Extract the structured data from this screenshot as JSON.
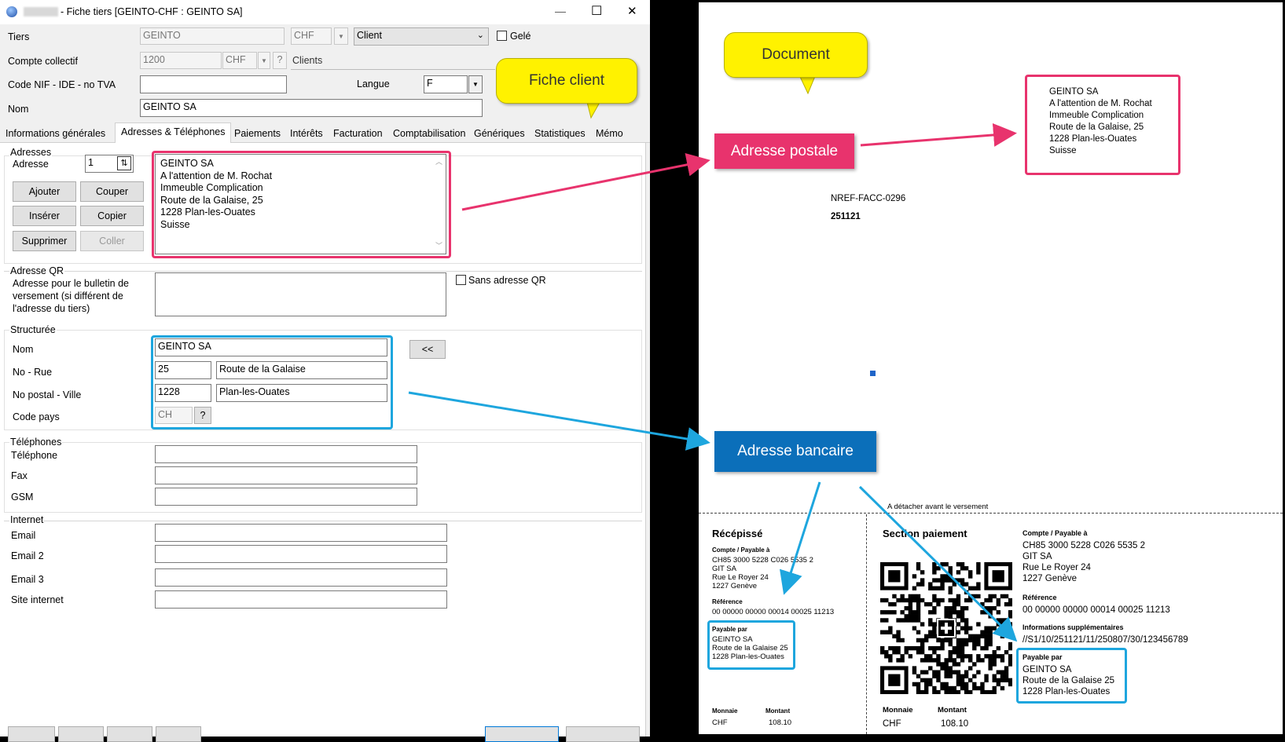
{
  "window": {
    "title": "- Fiche tiers [GEINTO-CHF : GEINTO SA]",
    "minimize": "—",
    "maximize": "☐",
    "close": "✕"
  },
  "header": {
    "tiers_label": "Tiers",
    "tiers_value": "GEINTO",
    "currency": "CHF",
    "type_value": "Client",
    "gele_label": "Gelé",
    "compte_label": "Compte collectif",
    "compte_value": "1200",
    "compte_currency": "CHF",
    "compte_help": "?",
    "compte_name": "Clients",
    "nif_label": "Code NIF - IDE - no TVA",
    "nif_value": "",
    "langue_label": "Langue",
    "langue_value": "F",
    "nom_label": "Nom",
    "nom_value": "GEINTO SA"
  },
  "tabs": [
    "Informations générales",
    "Adresses & Téléphones",
    "Paiements",
    "Intérêts",
    "Facturation",
    "Comptabilisation",
    "Génériques",
    "Statistiques",
    "Mémo"
  ],
  "adresses": {
    "group_label": "Adresses",
    "adresse_label": "Adresse",
    "adresse_index": "1",
    "lines": [
      "GEINTO SA",
      "A l'attention de M. Rochat",
      "Immeuble Complication",
      "Route de la Galaise, 25",
      "1228 Plan-les-Ouates",
      "Suisse"
    ],
    "buttons": {
      "ajouter": "Ajouter",
      "couper": "Couper",
      "inserer": "Insérer",
      "copier": "Copier",
      "supprimer": "Supprimer",
      "coller": "Coller"
    }
  },
  "adresse_qr": {
    "group_label": "Adresse QR",
    "description": [
      "Adresse pour le bulletin de",
      "versement (si différent de",
      "l'adresse du tiers)"
    ],
    "sans_label": "Sans adresse QR"
  },
  "structuree": {
    "group_label": "Structurée",
    "nom_label": "Nom",
    "nom_value": "GEINTO SA",
    "rue_label": "No - Rue",
    "no_value": "25",
    "rue_value": "Route de la Galaise",
    "ville_label": "No postal - Ville",
    "npa_value": "1228",
    "ville_value": "Plan-les-Ouates",
    "pays_label": "Code pays",
    "pays_value": "CH",
    "pays_help": "?",
    "copy_button": "<<"
  },
  "telephones": {
    "group_label": "Téléphones",
    "telephone_label": "Téléphone",
    "fax_label": "Fax",
    "gsm_label": "GSM"
  },
  "internet": {
    "group_label": "Internet",
    "email_label": "Email",
    "email2_label": "Email 2",
    "email3_label": "Email 3",
    "site_label": "Site internet"
  },
  "callouts": {
    "fiche_client": "Fiche client",
    "document": "Document"
  },
  "banners": {
    "postale": "Adresse postale",
    "bancaire": "Adresse bancaire"
  },
  "document": {
    "address": [
      "GEINTO SA",
      "A l'attention de M. Rochat",
      "Immeuble Complication",
      "Route de la Galaise, 25",
      "1228 Plan-les-Ouates",
      "Suisse"
    ],
    "ref": "NREF-FACC-0296",
    "date": "251121",
    "detach": "A détacher avant le versement",
    "recepisse": {
      "title": "Récépissé",
      "compte_label": "Compte / Payable à",
      "compte_lines": [
        "CH85 3000 5228 C026 5535 2",
        "GIT SA",
        "Rue Le Royer 24",
        "1227 Genève"
      ],
      "ref_label": "Référence",
      "ref_value": "00 00000 00000 00014 00025 11213",
      "payable_label": "Payable par",
      "payable_lines": [
        "GEINTO SA",
        "Route de la Galaise 25",
        "1228 Plan-les-Ouates"
      ],
      "monnaie_label": "Monnaie",
      "montant_label": "Montant",
      "monnaie_value": "CHF",
      "montant_value": "108.10"
    },
    "paiement": {
      "title": "Section paiement",
      "compte_label": "Compte / Payable à",
      "compte_lines": [
        "CH85 3000 5228 C026 5535 2",
        "GIT SA",
        "Rue Le Royer 24",
        "1227 Genève"
      ],
      "ref_label": "Référence",
      "ref_value": "00 00000 00000 00014 00025 11213",
      "info_label": "Informations supplémentaires",
      "info_value": "//S1/10/251121/11/250807/30/123456789",
      "payable_label": "Payable par",
      "payable_lines": [
        "GEINTO SA",
        "Route de la Galaise 25",
        "1228 Plan-les-Ouates"
      ],
      "monnaie_label": "Monnaie",
      "montant_label": "Montant",
      "monnaie_value": "CHF",
      "montant_value": "108.10"
    }
  },
  "colors": {
    "pink": "#e8336d",
    "blue": "#1ea6de",
    "banner_blue": "#0b6fba",
    "callout_yellow": "#fff200"
  }
}
